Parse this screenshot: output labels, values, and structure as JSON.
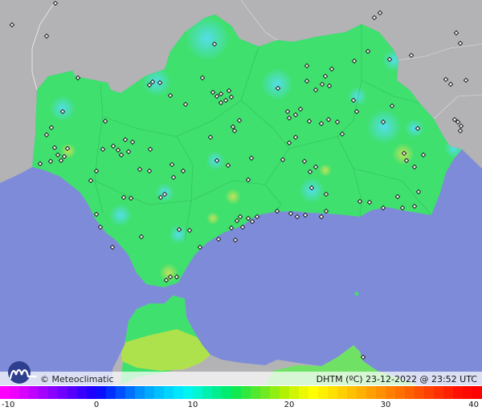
{
  "map": {
    "colors": {
      "sea": "#7e8bd8",
      "outer_land": "#b3b3b5",
      "land": "#3fe06e",
      "cool_spot": "#55ddf0",
      "warm_spot": "#c9e258",
      "station": "#1a1a1a",
      "border": "#ffffff"
    }
  },
  "footer": {
    "brand": "© Meteoclimatic",
    "caption": "DHTM (ºC)  23-12-2022 @ 23:52 UTC"
  },
  "legend": {
    "min": -10,
    "max": 40,
    "ticks": [
      {
        "value": -10,
        "label": "-10"
      },
      {
        "value": 0,
        "label": "0"
      },
      {
        "value": 10,
        "label": "10"
      },
      {
        "value": 20,
        "label": "20"
      },
      {
        "value": 30,
        "label": "30"
      },
      {
        "value": 40,
        "label": "40"
      }
    ],
    "colors": [
      "#ff00ff",
      "#ee00ff",
      "#d600ff",
      "#bd00ff",
      "#a300ff",
      "#8a00ff",
      "#7000ff",
      "#5500ff",
      "#3a00ff",
      "#2000ff",
      "#0a10ff",
      "#0030ff",
      "#0050ff",
      "#0070ff",
      "#0090ff",
      "#00aaff",
      "#00c0ff",
      "#00d4ff",
      "#00e6ff",
      "#00f5f0",
      "#00f5d0",
      "#00f0b0",
      "#00ee90",
      "#00ec70",
      "#10ea50",
      "#30e840",
      "#50e830",
      "#70ea20",
      "#90ee10",
      "#b0f000",
      "#d0f500",
      "#eaf800",
      "#ffff00",
      "#fff000",
      "#ffe000",
      "#ffd000",
      "#ffc000",
      "#ffb000",
      "#ffa000",
      "#ff9000",
      "#ff8000",
      "#ff7000",
      "#ff6000",
      "#ff5000",
      "#ff4000",
      "#ff3000",
      "#ff2000",
      "#ff1000",
      "#ff0800",
      "#ff0000"
    ]
  }
}
